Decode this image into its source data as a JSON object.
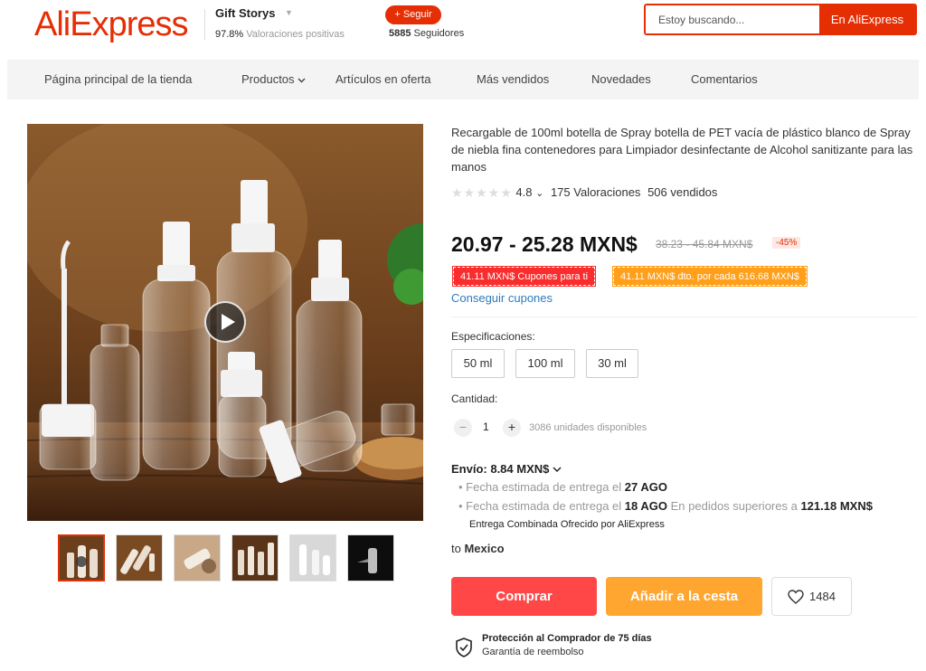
{
  "brand": {
    "logo": "AliExpress",
    "color": "#e62e04"
  },
  "store": {
    "name": "Gift Storys",
    "rating_value": "97.8%",
    "rating_text": "Valoraciones positivas",
    "follow_label": "+ Seguir",
    "followers_count": "5885",
    "followers_text": "Seguidores"
  },
  "search": {
    "placeholder": "Estoy buscando...",
    "button_label": "En AliExpress"
  },
  "nav": {
    "items": [
      {
        "label": "Página principal de la tienda"
      },
      {
        "label": "Productos"
      },
      {
        "label": "Artículos en oferta"
      },
      {
        "label": "Más vendidos"
      },
      {
        "label": "Novedades"
      },
      {
        "label": "Comentarios"
      }
    ]
  },
  "product": {
    "title": "Recargable de 100ml botella de Spray botella de PET vacía de plástico blanco de Spray de niebla fina contenedores para Limpiador desinfectante de Alcohol sanitizante para las manos",
    "rating": "4.8",
    "rating_caret": "⌄",
    "reviews": "175 Valoraciones",
    "sold": "506 vendidos",
    "price": "20.97 - 25.28 MXN$",
    "original_price": "38.23 - 45.84 MXN$",
    "discount": "-45%",
    "coupon_1": "41.11 MXN$ Cupones para ti",
    "coupon_2": "41.11 MXN$ dto. por cada 616.68 MXN$",
    "get_coupons": "Conseguir cupones",
    "spec_label": "Especificaciones:",
    "specs": [
      "50 ml",
      "100 ml",
      "30 ml"
    ],
    "quantity_label": "Cantidad:",
    "quantity": "1",
    "minus": "−",
    "plus": "+",
    "available": "3086 unidades disponibles",
    "shipping": "Envío: 8.84 MXN$",
    "delivery_1_text": "Fecha estimada de entrega el",
    "delivery_1_date": "27 AGO",
    "delivery_2_text": "Fecha estimada de entrega el",
    "delivery_2_date": "18 AGO",
    "delivery_2_cond": "En pedidos superiores a",
    "delivery_2_amount": "121.18 MXN$",
    "combined": "Entrega Combinada  Ofrecido por AliExpress",
    "to_label": "to",
    "to_country": "Mexico",
    "buy_label": "Comprar",
    "cart_label": "Añadir a la cesta",
    "wishlist_count": "1484",
    "protection_title": "Protección al Comprador de 75 días",
    "protection_sub": "Garantía de reembolso"
  },
  "colors": {
    "buy": "#ff4747",
    "cart": "#ffa630",
    "coupon_red": "#f92d2d",
    "coupon_orange": "#ff9f1a",
    "link": "#2e7bbd"
  }
}
